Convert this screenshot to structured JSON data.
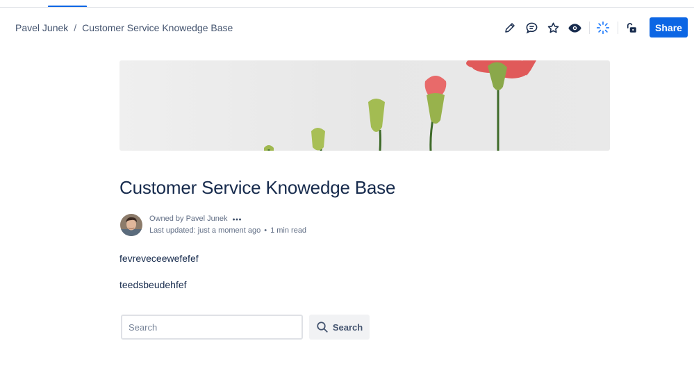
{
  "breadcrumb": {
    "space": "Pavel Junek",
    "separator": "/",
    "page": "Customer Service Knowedge Base"
  },
  "toolbar": {
    "icons": [
      "pencil-icon",
      "comment-icon",
      "star-icon",
      "eye-icon",
      "loading-spinner-icon",
      "unlock-icon"
    ],
    "share_label": "Share",
    "accent": "#0C66E4"
  },
  "page": {
    "title": "Customer Service Knowedge Base",
    "owner": "Owned by Pavel Junek",
    "last_updated": "Last updated: just a moment ago",
    "dot": "•",
    "read_time": "1 min read"
  },
  "body": {
    "paragraphs": [
      "fevreveceewefefef",
      "teedsbeudehfef"
    ]
  },
  "search": {
    "placeholder": "Search",
    "button_label": "Search"
  }
}
